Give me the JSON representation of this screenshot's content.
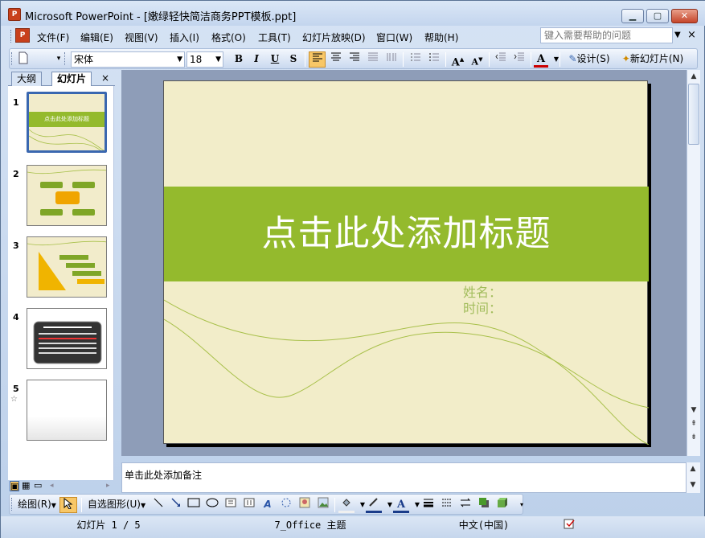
{
  "window": {
    "title": "Microsoft PowerPoint - [嫩绿轻快简洁商务PPT模板.ppt]",
    "min": "▁",
    "max": "▢",
    "close": "✕"
  },
  "menu": {
    "items": [
      "文件(F)",
      "编辑(E)",
      "视图(V)",
      "插入(I)",
      "格式(O)",
      "工具(T)",
      "幻灯片放映(D)",
      "窗口(W)",
      "帮助(H)"
    ],
    "help_placeholder": "键入需要帮助的问题",
    "close": "×"
  },
  "toolbar": {
    "font_name": "宋体",
    "font_size": "18",
    "bold": "B",
    "italic": "I",
    "underline": "U",
    "shadow": "S",
    "design": "设计(S)",
    "new_slide": "新幻灯片(N)"
  },
  "pane": {
    "tab_outline": "大纲",
    "tab_slides": "幻灯片",
    "close": "×",
    "slides": [
      {
        "num": "1",
        "title": "点击此处添加标题"
      },
      {
        "num": "2"
      },
      {
        "num": "3"
      },
      {
        "num": "4"
      },
      {
        "num": "5"
      }
    ]
  },
  "slide": {
    "title": "点击此处添加标题",
    "name_label": "姓名：",
    "time_label": "时间：",
    "colors": {
      "background": "#f2edc9",
      "band": "#94ba2d",
      "subtitle": "#a3bd5d",
      "curve": "#a8c04a"
    }
  },
  "notes": {
    "placeholder": "单击此处添加备注"
  },
  "drawing": {
    "draw": "绘图(R)",
    "autoshapes": "自选图形(U)"
  },
  "status": {
    "slide": "幻灯片 1 / 5",
    "theme": "7_Office 主题",
    "lang": "中文(中国)"
  }
}
